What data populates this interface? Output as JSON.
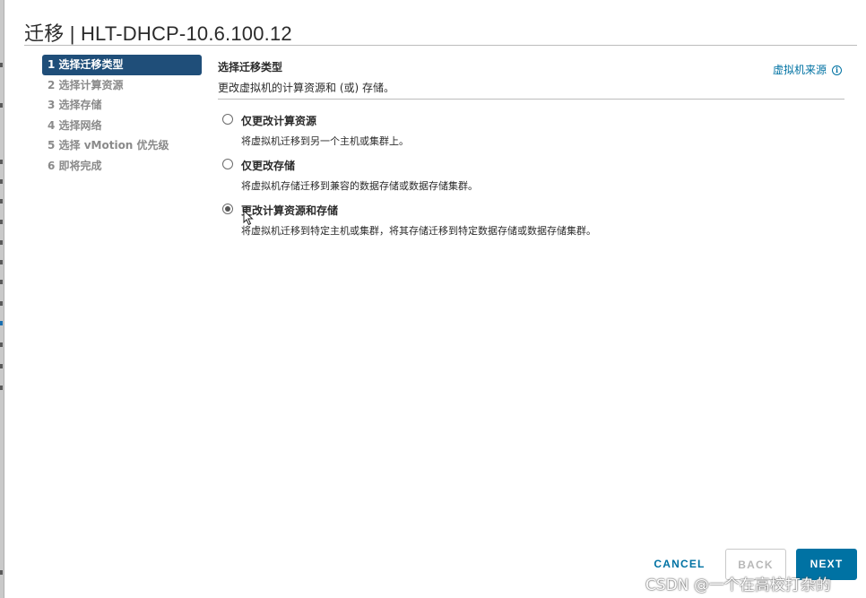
{
  "window": {
    "title": "迁移 | HLT-DHCP-10.6.100.12"
  },
  "steps": [
    {
      "label": "1 选择迁移类型",
      "active": true
    },
    {
      "label": "2 选择计算资源",
      "active": false
    },
    {
      "label": "3 选择存储",
      "active": false
    },
    {
      "label": "4 选择网络",
      "active": false
    },
    {
      "label": "5 选择 vMotion 优先级",
      "active": false
    },
    {
      "label": "6 即将完成",
      "active": false
    }
  ],
  "main": {
    "title": "选择迁移类型",
    "subtitle": "更改虚拟机的计算资源和 (或) 存储。",
    "source_link": "虚拟机来源",
    "info_icon": "i",
    "options": [
      {
        "label": "仅更改计算资源",
        "description": "将虚拟机迁移到另一个主机或集群上。",
        "selected": false
      },
      {
        "label": "仅更改存储",
        "description": "将虚拟机存储迁移到兼容的数据存储或数据存储集群。",
        "selected": false
      },
      {
        "label": "更改计算资源和存储",
        "description": "将虚拟机迁移到特定主机或集群，将其存储迁移到特定数据存储或数据存储集群。",
        "selected": true
      }
    ]
  },
  "footer": {
    "cancel_label": "CANCEL",
    "back_label": "BACK",
    "next_label": "NEXT"
  },
  "watermark": "CSDN @一个在高校打杂的",
  "colors": {
    "accent": "#0072a3",
    "active_step": "#1f4e79",
    "disabled": "#b7b7b7"
  }
}
